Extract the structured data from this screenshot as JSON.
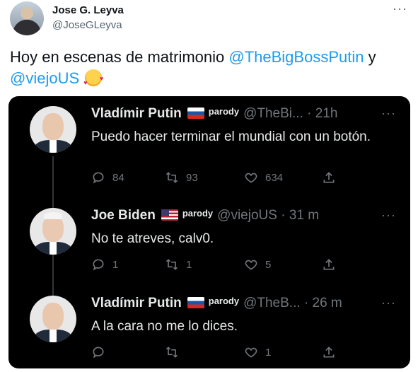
{
  "outer": {
    "name": "Jose G. Leyva",
    "handle": "@JoseGLeyva",
    "more": "···",
    "text_before": "Hoy en escenas de matrimonio ",
    "mention1": "@TheBigBossPutin",
    "text_middle": " y",
    "mention2": "@viejoUS"
  },
  "tweets": [
    {
      "name": "Vladímir Putin",
      "parody": "parody",
      "handle_time": "@TheBi... · 21h",
      "text": "Puedo hacer terminar el mundial con un botón.",
      "replies": "84",
      "retweets": "93",
      "likes": "634"
    },
    {
      "name": "Joe Biden",
      "parody": "parody",
      "handle_time": "@viejoUS · 31 m",
      "text": "No te atreves, calv0.",
      "replies": "1",
      "retweets": "1",
      "likes": "5"
    },
    {
      "name": "Vladímir Putin",
      "parody": "parody",
      "handle_time": "@TheB... · 26 m",
      "text": "A la cara no me lo dices.",
      "replies": "",
      "retweets": "",
      "likes": "1"
    }
  ],
  "colors": {
    "accent": "#1d9bf0",
    "dark_bg": "#000000",
    "muted": "#71767b"
  }
}
